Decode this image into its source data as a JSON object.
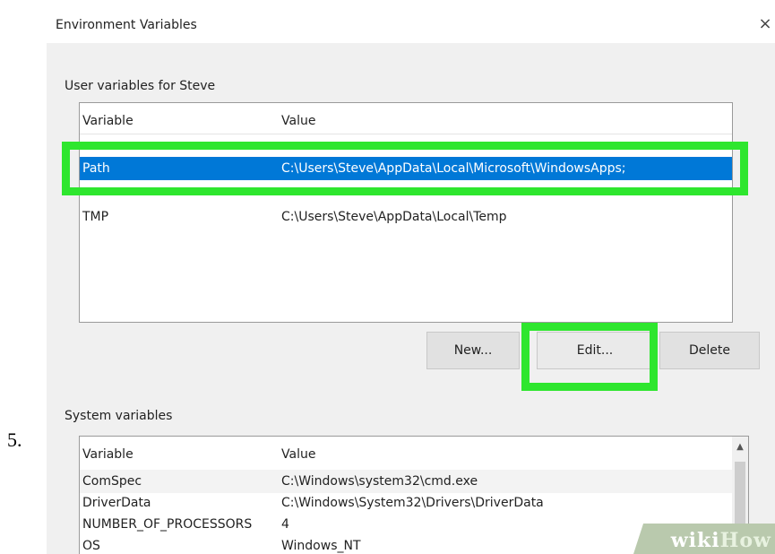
{
  "step_number": "5.",
  "dialog": {
    "title": "Environment Variables",
    "close_glyph": "×"
  },
  "user_vars": {
    "label": "User variables for Steve",
    "col_variable": "Variable",
    "col_value": "Value",
    "rows": [
      {
        "name": "Path",
        "value": "C:\\Users\\Steve\\AppData\\Local\\Microsoft\\WindowsApps;",
        "selected": true
      },
      {
        "name": "TMP",
        "value": "C:\\Users\\Steve\\AppData\\Local\\Temp",
        "selected": false
      }
    ]
  },
  "buttons": {
    "new": "New...",
    "edit": "Edit...",
    "delete": "Delete"
  },
  "system_vars": {
    "label": "System variables",
    "col_variable": "Variable",
    "col_value": "Value",
    "rows": [
      {
        "name": "ComSpec",
        "value": "C:\\Windows\\system32\\cmd.exe"
      },
      {
        "name": "DriverData",
        "value": "C:\\Windows\\System32\\Drivers\\DriverData"
      },
      {
        "name": "NUMBER_OF_PROCESSORS",
        "value": "4"
      },
      {
        "name": "OS",
        "value": "Windows_NT"
      }
    ]
  },
  "watermark": {
    "wiki": "wiki",
    "how": "How"
  },
  "colors": {
    "highlight": "#2ee62e",
    "selection": "#0078d7"
  }
}
